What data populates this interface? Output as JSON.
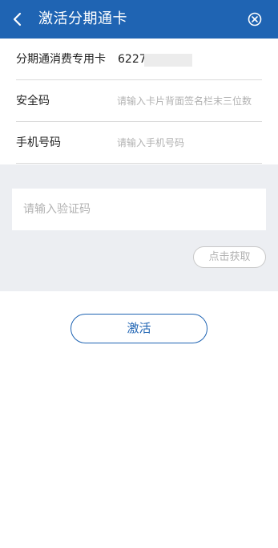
{
  "header": {
    "title": "激活分期通卡",
    "back_icon": "chevron-left-icon",
    "close_icon": "close-circle-icon",
    "color": "#1f64b3"
  },
  "form": {
    "card": {
      "label": "分期通消费专用卡",
      "value": "6227"
    },
    "security_code": {
      "label": "安全码",
      "placeholder": "请输入卡片背面签名栏末三位数"
    },
    "phone": {
      "label": "手机号码",
      "placeholder": "请输入手机号码"
    }
  },
  "verify": {
    "placeholder": "请输入验证码",
    "get_code_label": "点击获取"
  },
  "actions": {
    "activate_label": "激活"
  }
}
